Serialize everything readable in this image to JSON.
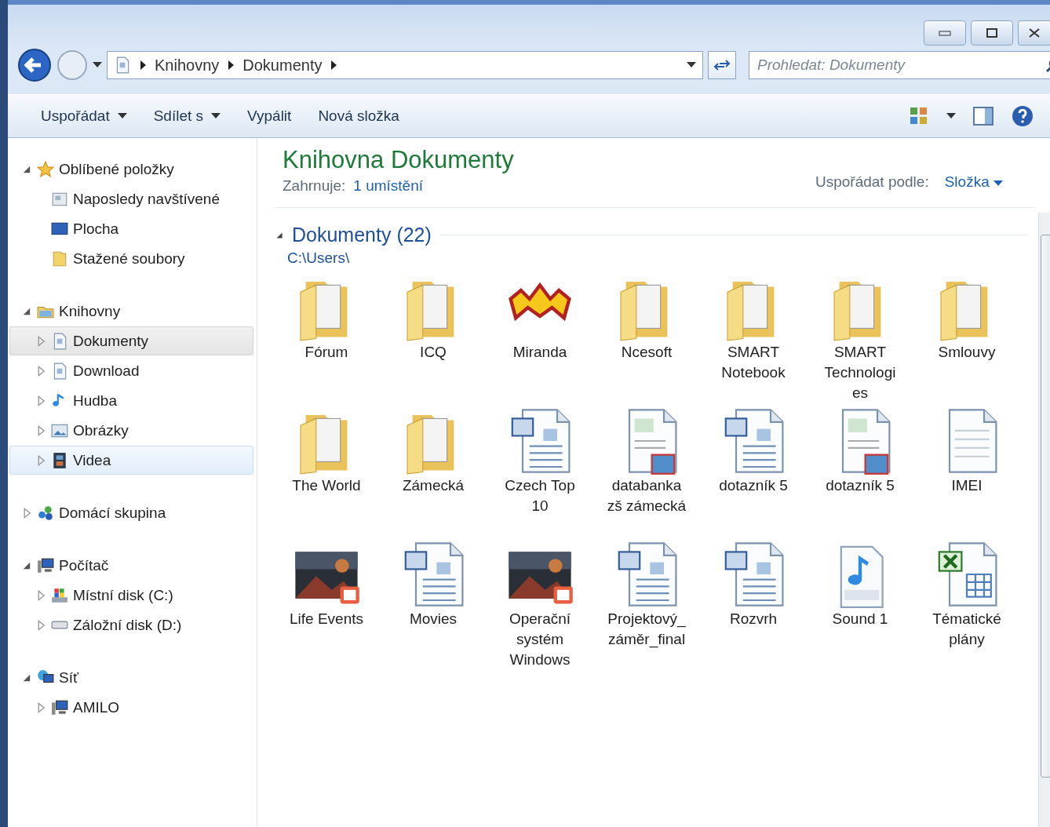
{
  "address": {
    "crumbs": [
      "Knihovny",
      "Dokumenty"
    ]
  },
  "search": {
    "placeholder": "Prohledat: Dokumenty"
  },
  "toolbar": [
    {
      "label": "Uspořádat",
      "dropdown": true
    },
    {
      "label": "Sdílet s",
      "dropdown": true
    },
    {
      "label": "Vypálit",
      "dropdown": false
    },
    {
      "label": "Nová složka",
      "dropdown": false
    }
  ],
  "nav": [
    {
      "label": "Oblíbené položky",
      "expanded": true,
      "selected": false,
      "hover": false,
      "children": [
        {
          "label": "Naposledy navštívené",
          "selected": false,
          "hover": false
        },
        {
          "label": "Plocha",
          "selected": false,
          "hover": false
        },
        {
          "label": "Stažené soubory",
          "selected": false,
          "hover": false
        }
      ]
    },
    {
      "label": "Knihovny",
      "expanded": true,
      "selected": false,
      "hover": false,
      "children": [
        {
          "label": "Dokumenty",
          "expanded": false,
          "selected": true,
          "hover": false
        },
        {
          "label": "Download",
          "expanded": false,
          "selected": false,
          "hover": false
        },
        {
          "label": "Hudba",
          "expanded": false,
          "selected": false,
          "hover": false
        },
        {
          "label": "Obrázky",
          "expanded": false,
          "selected": false,
          "hover": false
        },
        {
          "label": "Videa",
          "expanded": false,
          "selected": false,
          "hover": true
        }
      ]
    },
    {
      "label": "Domácí skupina",
      "expanded": false,
      "selected": false,
      "hover": false
    },
    {
      "label": "Počítač",
      "expanded": true,
      "selected": false,
      "hover": false,
      "children": [
        {
          "label": "Místní disk (C:)",
          "expanded": false,
          "selected": false,
          "hover": false
        },
        {
          "label": "Záložní disk (D:)",
          "expanded": false,
          "selected": false,
          "hover": false
        }
      ]
    },
    {
      "label": "Síť",
      "expanded": true,
      "selected": false,
      "hover": false,
      "children": [
        {
          "label": "AMILO",
          "expanded": false,
          "selected": false,
          "hover": false
        }
      ]
    }
  ],
  "header": {
    "title": "Knihovna Dokumenty",
    "includes_label": "Zahrnuje:",
    "includes_link": "1 umístění",
    "arrange_label": "Uspořádat podle:",
    "arrange_value": "Složka"
  },
  "group": {
    "title": "Dokumenty (22)",
    "expanded": true,
    "path": "C:\\Users\\"
  },
  "files": [
    {
      "lines": [
        "Fórum"
      ],
      "kind": "folder"
    },
    {
      "lines": [
        "ICQ"
      ],
      "kind": "folder"
    },
    {
      "lines": [
        "Miranda"
      ],
      "kind": "app"
    },
    {
      "lines": [
        "Ncesoft"
      ],
      "kind": "folder"
    },
    {
      "lines": [
        "SMART",
        "Notebook"
      ],
      "kind": "folder"
    },
    {
      "lines": [
        "SMART",
        "Technologi",
        "es"
      ],
      "kind": "folder"
    },
    {
      "lines": [
        "Smlouvy"
      ],
      "kind": "folder"
    },
    {
      "lines": [
        "The World"
      ],
      "kind": "folder"
    },
    {
      "lines": [
        "Zámecká"
      ],
      "kind": "folder"
    },
    {
      "lines": [
        "Czech Top",
        "10"
      ],
      "kind": "word"
    },
    {
      "lines": [
        "databanka",
        "zš zámecká"
      ],
      "kind": "preview"
    },
    {
      "lines": [
        "dotazník 5"
      ],
      "kind": "word"
    },
    {
      "lines": [
        "dotazník 5"
      ],
      "kind": "preview"
    },
    {
      "lines": [
        "IMEI"
      ],
      "kind": "text"
    },
    {
      "lines": [
        "Life Events"
      ],
      "kind": "video"
    },
    {
      "lines": [
        "Movies"
      ],
      "kind": "word"
    },
    {
      "lines": [
        "Operační",
        "systém",
        "Windows"
      ],
      "kind": "video"
    },
    {
      "lines": [
        "Projektový_",
        "záměr_final"
      ],
      "kind": "word"
    },
    {
      "lines": [
        "Rozvrh"
      ],
      "kind": "word"
    },
    {
      "lines": [
        "Sound 1"
      ],
      "kind": "mp3"
    },
    {
      "lines": [
        "Tématické",
        "plány"
      ],
      "kind": "excel"
    }
  ]
}
